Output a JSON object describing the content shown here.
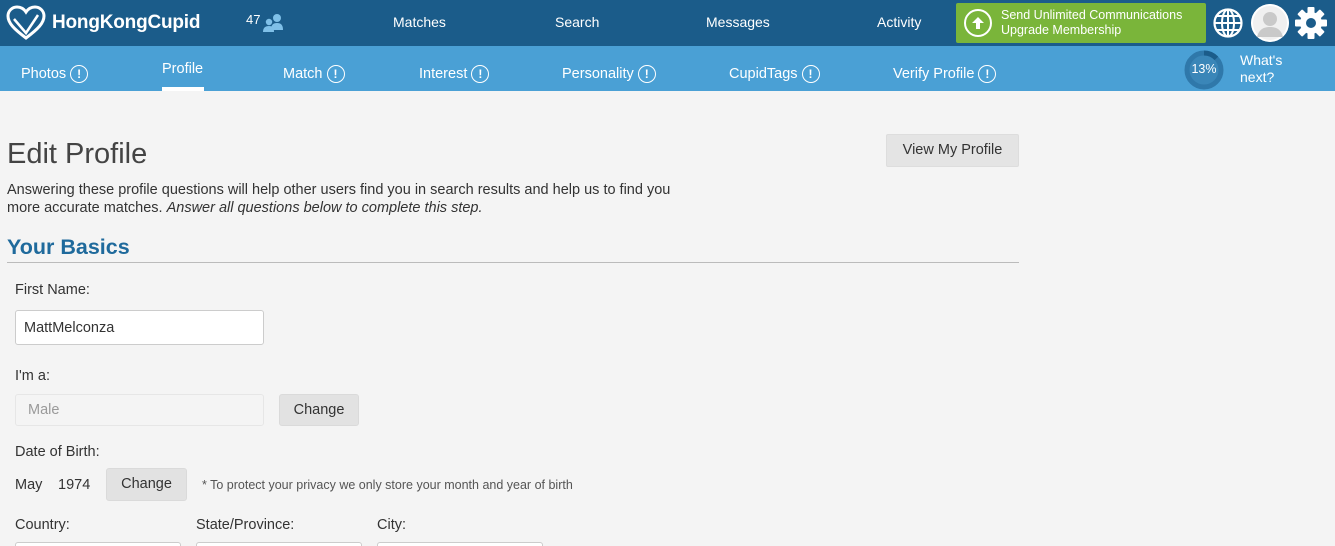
{
  "header": {
    "brand": "HongKongCupid",
    "online_count": "47",
    "nav": [
      "Matches",
      "Search",
      "Messages",
      "Activity"
    ],
    "upgrade": {
      "line1": "Send Unlimited Communications",
      "line2": "Upgrade Membership"
    },
    "icons": {
      "globe": "globe-icon",
      "avatar": "avatar",
      "settings": "gear-icon"
    },
    "colors": {
      "bar": "#1b5c8a",
      "upgrade": "#7ab53a"
    }
  },
  "subnav": {
    "items": [
      {
        "label": "Photos",
        "alert": "!"
      },
      {
        "label": "Profile",
        "active": true
      },
      {
        "label": "Match",
        "alert": "!"
      },
      {
        "label": "Interest",
        "alert": "!"
      },
      {
        "label": "Personality",
        "alert": "!"
      },
      {
        "label": "CupidTags",
        "alert": "!"
      },
      {
        "label": "Verify Profile",
        "alert": "!"
      }
    ],
    "progress": {
      "percent": 13,
      "label": "13%"
    },
    "whats_next": {
      "line1": "What's",
      "line2": "next?"
    },
    "color": "#4aa0d5"
  },
  "main": {
    "view_profile_button": "View My Profile",
    "title": "Edit Profile",
    "intro": "Answering these profile questions will help other users find you in search results and help us to find you more accurate matches.",
    "intro_emphasis": "Answer all questions below to complete this step.",
    "section_title": "Your Basics",
    "first_name": {
      "label": "First Name:",
      "value": "MattMelconza"
    },
    "gender": {
      "label": "I'm a:",
      "value": "Male",
      "change": "Change"
    },
    "dob": {
      "label": "Date of Birth:",
      "month": "May",
      "year": "1974",
      "change": "Change",
      "note": "* To protect your privacy we only store your month and year of birth"
    },
    "location": {
      "country_label": "Country:",
      "state_label": "State/Province:",
      "city_label": "City:"
    }
  }
}
